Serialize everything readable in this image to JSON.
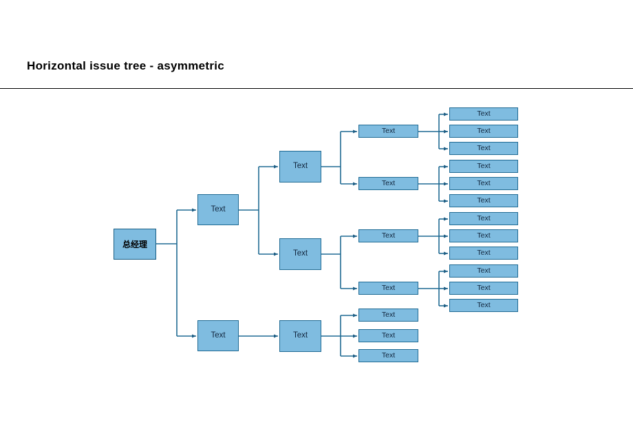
{
  "header": {
    "title": "Horizontal issue tree - asymmetric"
  },
  "theme": {
    "node_fill": "#7FBCE0",
    "node_border": "#1F6A93",
    "connector": "#1F6A93",
    "title_color": "#000000",
    "background": "#ffffff"
  },
  "diagram": {
    "type": "horizontal-issue-tree",
    "root": {
      "label": "总经理"
    },
    "level2": [
      {
        "label": "Text"
      },
      {
        "label": "Text"
      }
    ],
    "level3": [
      {
        "label": "Text"
      },
      {
        "label": "Text"
      },
      {
        "label": "Text"
      }
    ],
    "level4": [
      {
        "label": "Text"
      },
      {
        "label": "Text"
      },
      {
        "label": "Text"
      },
      {
        "label": "Text"
      },
      {
        "label": "Text"
      },
      {
        "label": "Text"
      },
      {
        "label": "Text"
      }
    ],
    "level5": [
      {
        "label": "Text"
      },
      {
        "label": "Text"
      },
      {
        "label": "Text"
      },
      {
        "label": "Text"
      },
      {
        "label": "Text"
      },
      {
        "label": "Text"
      },
      {
        "label": "Text"
      },
      {
        "label": "Text"
      },
      {
        "label": "Text"
      },
      {
        "label": "Text"
      },
      {
        "label": "Text"
      },
      {
        "label": "Text"
      }
    ]
  }
}
